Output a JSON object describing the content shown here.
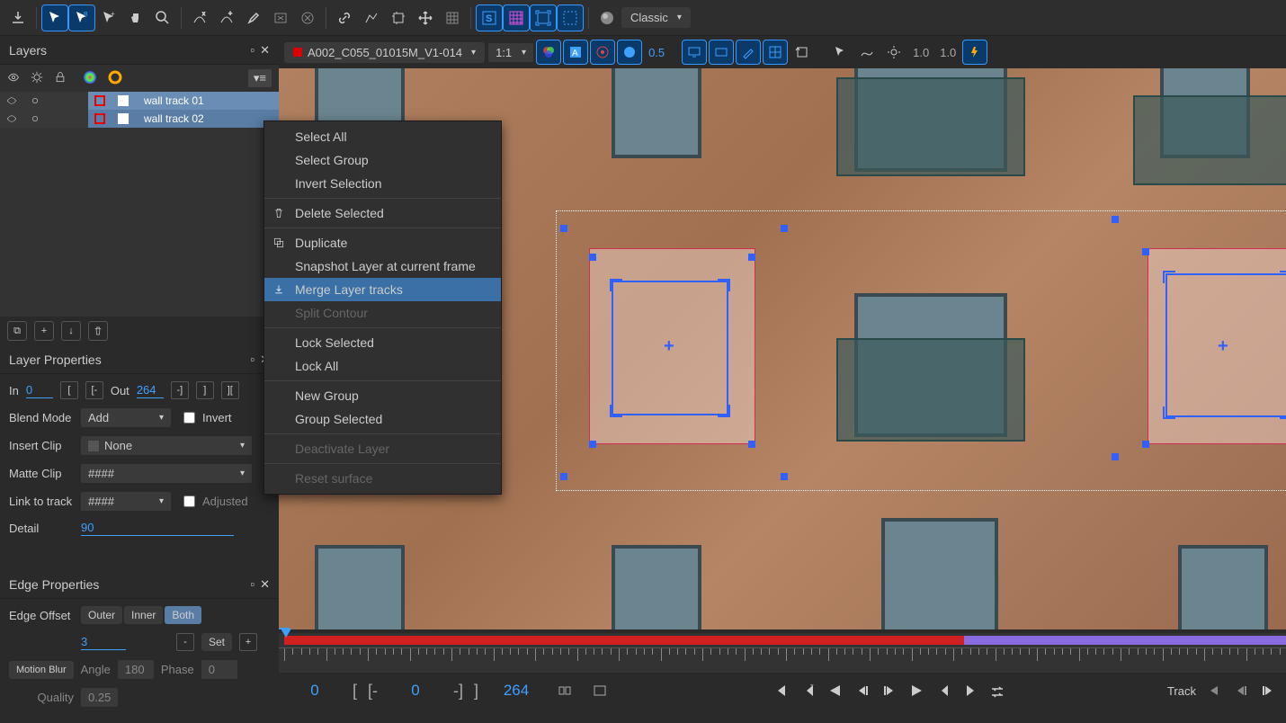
{
  "toolbar": {
    "workspace_label": "Classic"
  },
  "secbar": {
    "clip_name": "A002_C055_01015M_V1-014",
    "zoom": "1:1",
    "opacity": "0.5",
    "val1": "1.0",
    "val2": "1.0"
  },
  "layers": {
    "title": "Layers",
    "items": [
      {
        "name": "wall track 01"
      },
      {
        "name": "wall track 02"
      }
    ]
  },
  "context_menu": {
    "items": [
      {
        "label": "Select All",
        "type": "item"
      },
      {
        "label": "Select Group",
        "type": "item"
      },
      {
        "label": "Invert Selection",
        "type": "item"
      },
      {
        "type": "sep"
      },
      {
        "label": "Delete Selected",
        "type": "item",
        "icon": "trash"
      },
      {
        "type": "sep"
      },
      {
        "label": "Duplicate",
        "type": "item",
        "icon": "dup"
      },
      {
        "label": "Snapshot Layer at current frame",
        "type": "item"
      },
      {
        "label": "Merge Layer tracks",
        "type": "item",
        "highlighted": true,
        "icon": "merge"
      },
      {
        "label": "Split Contour",
        "type": "item",
        "disabled": true
      },
      {
        "type": "sep"
      },
      {
        "label": "Lock Selected",
        "type": "item"
      },
      {
        "label": "Lock All",
        "type": "item"
      },
      {
        "type": "sep"
      },
      {
        "label": "New Group",
        "type": "item"
      },
      {
        "label": "Group Selected",
        "type": "item"
      },
      {
        "type": "sep"
      },
      {
        "label": "Deactivate Layer",
        "type": "item",
        "disabled": true
      },
      {
        "type": "sep"
      },
      {
        "label": "Reset surface",
        "type": "item",
        "disabled": true
      }
    ]
  },
  "layer_props": {
    "title": "Layer Properties",
    "in_label": "In",
    "in_value": "0",
    "out_label": "Out",
    "out_value": "264",
    "blend_label": "Blend Mode",
    "blend_value": "Add",
    "invert_label": "Invert",
    "insert_label": "Insert Clip",
    "insert_value": "None",
    "matte_label": "Matte Clip",
    "matte_value": "####",
    "link_label": "Link to track",
    "link_value": "####",
    "adjusted_label": "Adjusted",
    "detail_label": "Detail",
    "detail_value": "90"
  },
  "edge_props": {
    "title": "Edge Properties",
    "offset_label": "Edge Offset",
    "tabs": {
      "outer": "Outer",
      "inner": "Inner",
      "both": "Both"
    },
    "offset_value": "3",
    "set_label": "Set",
    "motion_label": "Motion Blur",
    "angle_label": "Angle",
    "angle_value": "180",
    "phase_label": "Phase",
    "phase_value": "0",
    "quality_label": "Quality",
    "quality_value": "0.25"
  },
  "timeline": {
    "start": "0",
    "mid": "0",
    "end": "264",
    "track_label": "Track"
  }
}
